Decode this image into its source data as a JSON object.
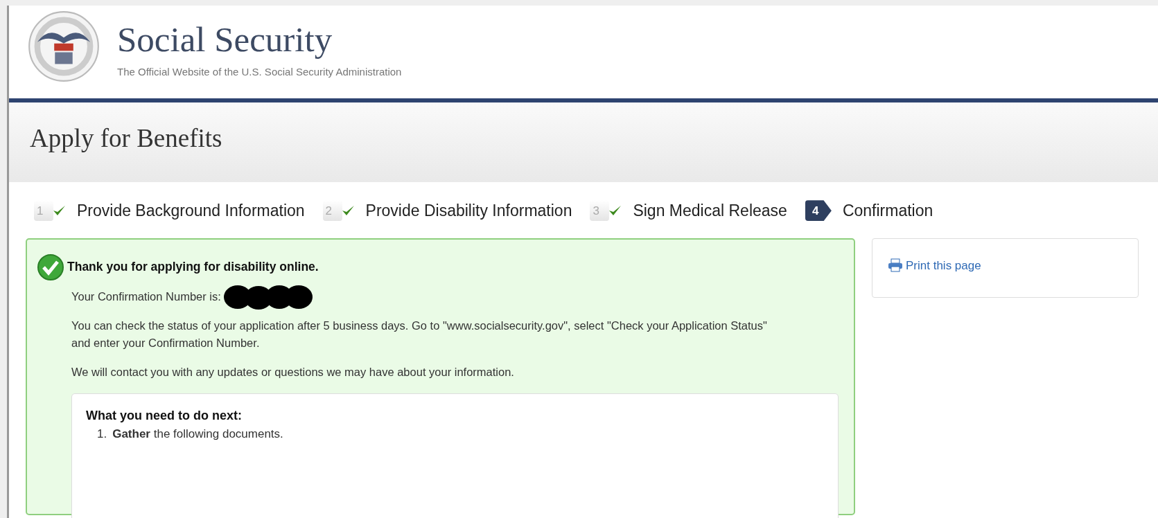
{
  "header": {
    "title": "Social Security",
    "subtitle": "The Official Website of the U.S. Social Security Administration"
  },
  "page_title": "Apply for Benefits",
  "steps": [
    {
      "number": "1",
      "label": "Provide Background Information",
      "completed": true,
      "selected": false
    },
    {
      "number": "2",
      "label": "Provide Disability Information",
      "completed": true,
      "selected": false
    },
    {
      "number": "3",
      "label": "Sign Medical Release",
      "completed": true,
      "selected": false
    },
    {
      "number": "4",
      "label": "Confirmation",
      "completed": false,
      "selected": true
    }
  ],
  "confirmation": {
    "heading": "Thank you for applying for disability online.",
    "number_label": "Your Confirmation Number is:",
    "number_redacted": true,
    "paragraphs": [
      "You can check the status of your application after 5 business days. Go to \"www.socialsecurity.gov\", select \"Check your Application Status\" and enter your Confirmation Number.",
      "We will contact you with any updates or questions we may have about your information."
    ],
    "next_steps": {
      "heading": "What you need to do next:",
      "items": [
        {
          "number": "1.",
          "text": "**Gather** the following documents."
        }
      ]
    }
  },
  "sidebar": {
    "print_link": "Print this page"
  }
}
